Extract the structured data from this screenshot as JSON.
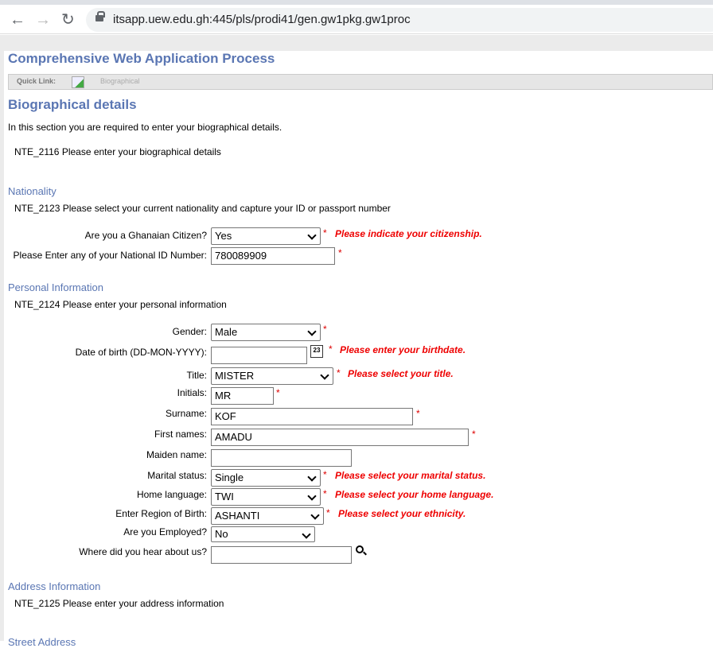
{
  "browser": {
    "url": "itsapp.uew.edu.gh:445/pls/prodi41/gen.gw1pkg.gw1proc"
  },
  "app_title": "Comprehensive Web Application Process",
  "quick_link": {
    "label": "Quick Link:",
    "item": "Biographical"
  },
  "page_title": "Biographical details",
  "intro": "In this section you are required to enter your biographical details.",
  "note_main": "NTE_2116 Please enter your biographical details",
  "nationality": {
    "heading": "Nationality",
    "note": "NTE_2123 Please select your current nationality and capture your ID or passport number",
    "citizen": {
      "label": "Are you a Ghanaian Citizen?",
      "value": "Yes",
      "error": "Please indicate your citizenship."
    },
    "national_id": {
      "label": "Please Enter any of your National ID Number:",
      "value": "780089909"
    }
  },
  "personal": {
    "heading": "Personal Information",
    "note": "NTE_2124 Please enter your personal information",
    "gender": {
      "label": "Gender:",
      "value": "Male"
    },
    "dob": {
      "label": "Date of birth (DD-MON-YYYY):",
      "value": "",
      "error": "Please enter your birthdate.",
      "calendar_text": "23"
    },
    "title": {
      "label": "Title:",
      "value": "MISTER",
      "error": "Please select your title."
    },
    "initials": {
      "label": "Initials:",
      "value": "MR"
    },
    "surname": {
      "label": "Surname:",
      "value": "KOF"
    },
    "first_names": {
      "label": "First names:",
      "value": "AMADU"
    },
    "maiden": {
      "label": "Maiden name:",
      "value": ""
    },
    "marital": {
      "label": "Marital status:",
      "value": "Single",
      "error": "Please select your marital status."
    },
    "home_language": {
      "label": "Home language:",
      "value": "TWI",
      "error": "Please select your home language."
    },
    "region": {
      "label": "Enter Region of Birth:",
      "value": "ASHANTI",
      "error": "Please select your ethnicity."
    },
    "employed": {
      "label": "Are you Employed?",
      "value": "No"
    },
    "hear": {
      "label": "Where did you hear about us?",
      "value": ""
    }
  },
  "address": {
    "heading": "Address Information",
    "note": "NTE_2125 Please enter your address information",
    "sub": "Street Address"
  },
  "required_mark": "*"
}
